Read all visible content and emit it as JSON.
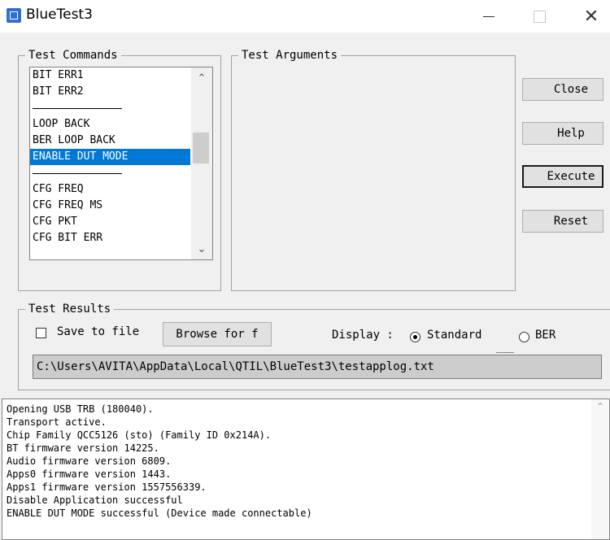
{
  "window": {
    "title": "BlueTest3",
    "minimize_glyph": "",
    "close_glyph": "✕"
  },
  "test_commands": {
    "legend": "Test Commands",
    "items": [
      {
        "label": "BIT ERR1",
        "type": "item",
        "selected": false
      },
      {
        "label": "BIT ERR2",
        "type": "item",
        "selected": false
      },
      {
        "label": "",
        "type": "separator",
        "selected": false
      },
      {
        "label": "LOOP BACK",
        "type": "item",
        "selected": false
      },
      {
        "label": "BER LOOP BACK",
        "type": "item",
        "selected": false
      },
      {
        "label": "ENABLE DUT MODE",
        "type": "item",
        "selected": true
      },
      {
        "label": "",
        "type": "separator",
        "selected": false
      },
      {
        "label": "CFG FREQ",
        "type": "item",
        "selected": false
      },
      {
        "label": "CFG FREQ MS",
        "type": "item",
        "selected": false
      },
      {
        "label": "CFG PKT",
        "type": "item",
        "selected": false
      },
      {
        "label": "CFG BIT ERR",
        "type": "item",
        "selected": false
      }
    ],
    "scroll_up_glyph": "⌃",
    "scroll_down_glyph": "⌄"
  },
  "test_arguments": {
    "legend": "Test Arguments"
  },
  "buttons": {
    "close": "Close",
    "help": "Help",
    "execute": "Execute",
    "reset": "Reset"
  },
  "test_results": {
    "legend": "Test Results",
    "save_to_file_label": "Save to file",
    "save_to_file_checked": false,
    "browse_label": "Browse for f",
    "display_label": "Display :",
    "display_options": [
      {
        "label": "Standard",
        "checked": true
      },
      {
        "label": "BER",
        "checked": false
      }
    ],
    "log_path": "C:\\Users\\AVITA\\AppData\\Local\\QTIL\\BlueTest3\\testapplog.txt"
  },
  "log": {
    "lines": [
      "Opening USB TRB (180040).",
      "Transport active.",
      "Chip Family QCC5126 (sto) (Family ID 0x214A).",
      "BT firmware version 14225.",
      "Audio firmware version 6809.",
      "Apps0 firmware version 1443.",
      "Apps1 firmware version 1557556339.",
      "Disable Application successful",
      "ENABLE DUT MODE successful (Device made connectable)"
    ]
  },
  "colors": {
    "selection": "#0078d7",
    "window_bg": "#f0f0f0"
  }
}
